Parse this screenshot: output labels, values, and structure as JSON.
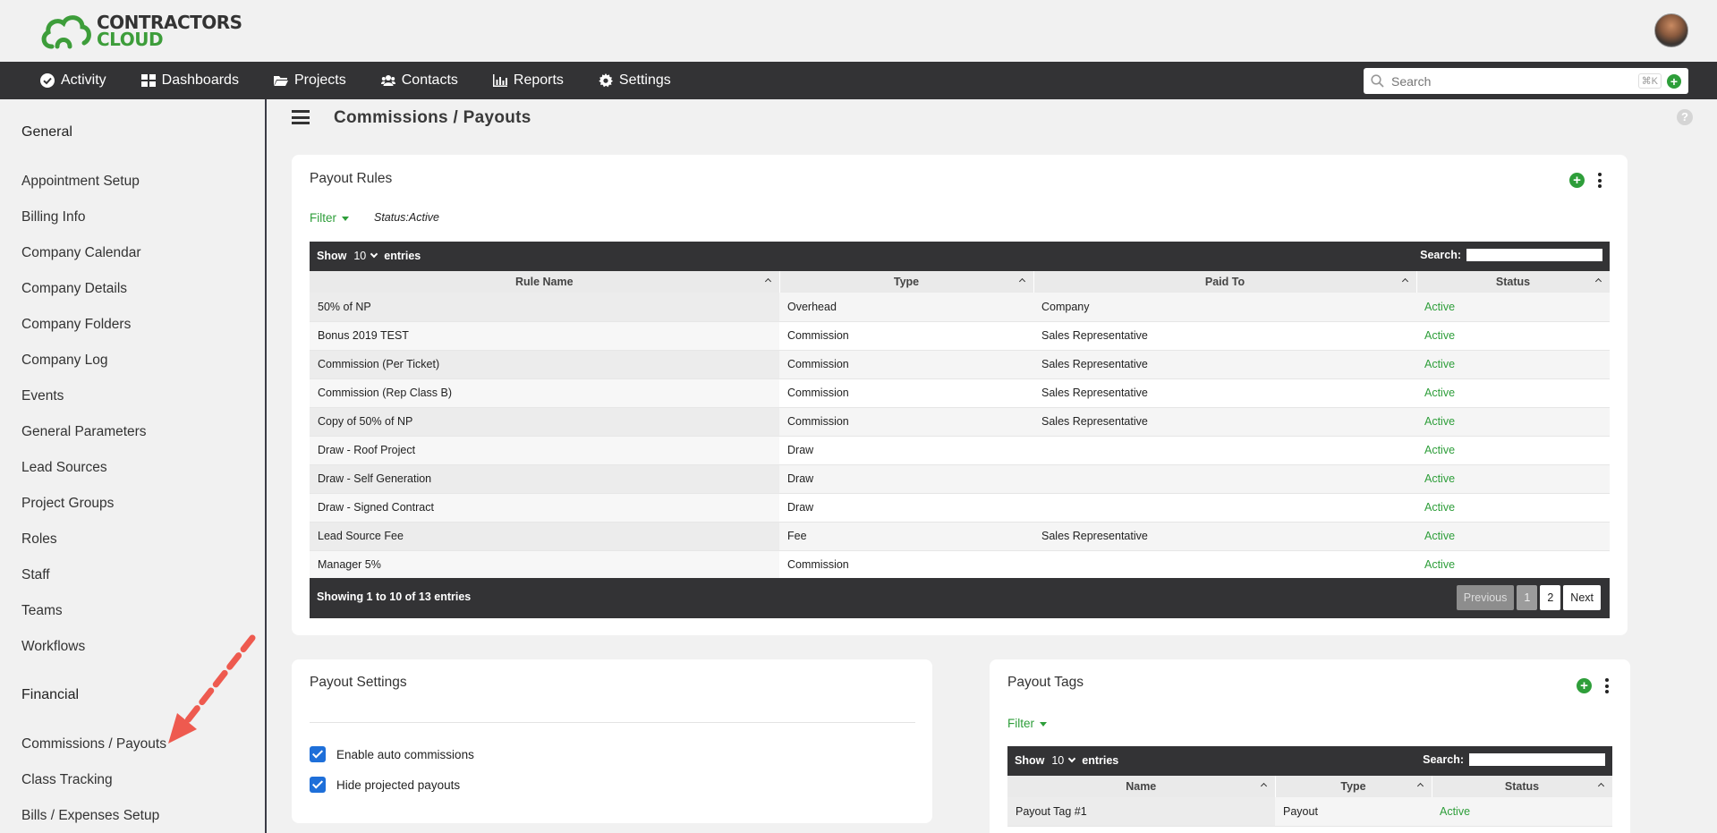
{
  "brand": {
    "line1": "CONTRACTORS",
    "line2": "CLOUD"
  },
  "nav": {
    "items": [
      {
        "label": "Activity",
        "icon": "check-circle-icon"
      },
      {
        "label": "Dashboards",
        "icon": "grid-icon"
      },
      {
        "label": "Projects",
        "icon": "folder-icon"
      },
      {
        "label": "Contacts",
        "icon": "users-icon"
      },
      {
        "label": "Reports",
        "icon": "bar-chart-icon"
      },
      {
        "label": "Settings",
        "icon": "gear-icon"
      }
    ],
    "search_placeholder": "Search",
    "search_shortcut": "⌘K"
  },
  "sidebar": {
    "general_heading": "General",
    "general_items": [
      "Appointment Setup",
      "Billing Info",
      "Company Calendar",
      "Company Details",
      "Company Folders",
      "Company Log",
      "Events",
      "General Parameters",
      "Lead Sources",
      "Project Groups",
      "Roles",
      "Staff",
      "Teams",
      "Workflows"
    ],
    "financial_heading": "Financial",
    "financial_items": [
      "Commissions / Payouts",
      "Class Tracking",
      "Bills / Expenses Setup"
    ]
  },
  "page": {
    "title": "Commissions / Payouts",
    "help": "?"
  },
  "payout_rules": {
    "title": "Payout Rules",
    "filter_label": "Filter",
    "filter_status": "Status:Active",
    "show_label": "Show",
    "page_size": "10",
    "entries_label": "entries",
    "search_label": "Search:",
    "columns": [
      "Rule Name",
      "Type",
      "Paid To",
      "Status"
    ],
    "rows": [
      [
        "50% of NP",
        "Overhead",
        "Company",
        "Active"
      ],
      [
        "Bonus 2019 TEST",
        "Commission",
        "Sales Representative",
        "Active"
      ],
      [
        "Commission (Per Ticket)",
        "Commission",
        "Sales Representative",
        "Active"
      ],
      [
        "Commission (Rep Class B)",
        "Commission",
        "Sales Representative",
        "Active"
      ],
      [
        "Copy of 50% of NP",
        "Commission",
        "Sales Representative",
        "Active"
      ],
      [
        "Draw - Roof Project",
        "Draw",
        "",
        "Active"
      ],
      [
        "Draw - Self Generation",
        "Draw",
        "",
        "Active"
      ],
      [
        "Draw - Signed Contract",
        "Draw",
        "",
        "Active"
      ],
      [
        "Lead Source Fee",
        "Fee",
        "Sales Representative",
        "Active"
      ],
      [
        "Manager 5%",
        "Commission",
        "",
        "Active"
      ]
    ],
    "info": "Showing 1 to 10 of 13 entries",
    "pager": {
      "previous": "Previous",
      "page1": "1",
      "page2": "2",
      "next": "Next"
    }
  },
  "payout_settings": {
    "title": "Payout Settings",
    "options": [
      "Enable auto commissions",
      "Hide projected payouts"
    ]
  },
  "payout_tags": {
    "title": "Payout Tags",
    "filter_label": "Filter",
    "show_label": "Show",
    "page_size": "10",
    "entries_label": "entries",
    "search_label": "Search:",
    "columns": [
      "Name",
      "Type",
      "Status"
    ],
    "rows": [
      [
        "Payout Tag #1",
        "Payout",
        "Active"
      ]
    ]
  },
  "colors": {
    "accent": "#2e9e3a",
    "navbar": "#333335",
    "checkbox": "#1e6fd9",
    "annotation": "#ee5a4f"
  }
}
